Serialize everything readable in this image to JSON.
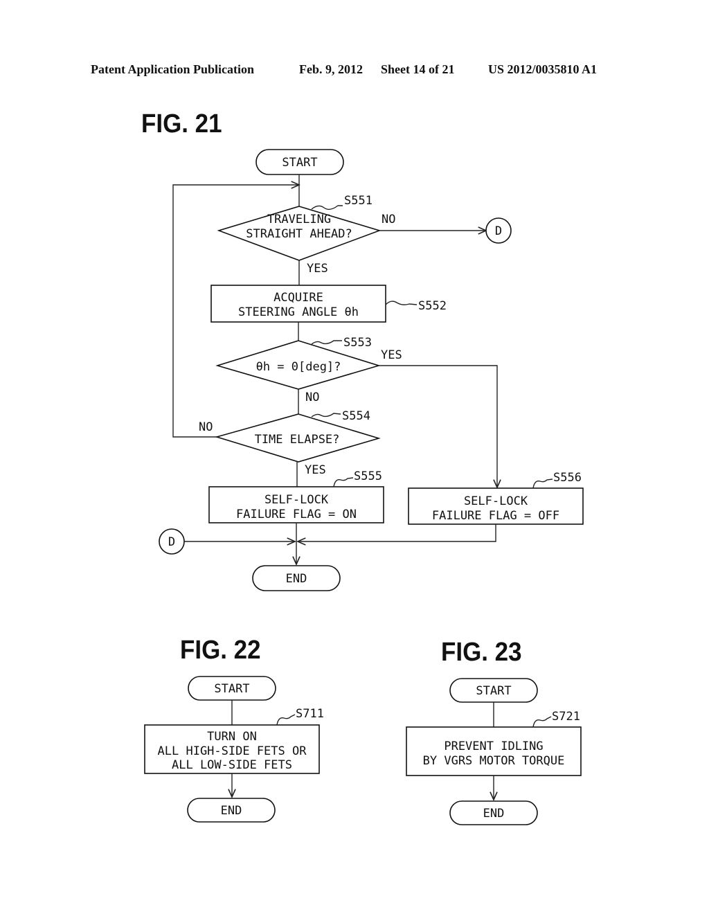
{
  "header": {
    "publication": "Patent Application Publication",
    "date": "Feb. 9, 2012",
    "sheet": "Sheet 14 of 21",
    "number": "US 2012/0035810 A1"
  },
  "fig21": {
    "title": "FIG. 21",
    "start": "START",
    "end": "END",
    "connector": "D",
    "s551": {
      "step": "S551",
      "line1": "TRAVELING",
      "line2": "STRAIGHT AHEAD?",
      "no": "NO",
      "yes": "YES"
    },
    "s552": {
      "step": "S552",
      "line1": "ACQUIRE",
      "line2": "STEERING ANGLE θh"
    },
    "s553": {
      "step": "S553",
      "text": "θh = 0[deg]?",
      "yes": "YES",
      "no": "NO"
    },
    "s554": {
      "step": "S554",
      "text": "TIME ELAPSE?",
      "no": "NO",
      "yes": "YES"
    },
    "s555": {
      "step": "S555",
      "line1": "SELF-LOCK",
      "line2": "FAILURE FLAG = ON"
    },
    "s556": {
      "step": "S556",
      "line1": "SELF-LOCK",
      "line2": "FAILURE FLAG = OFF"
    }
  },
  "fig22": {
    "title": "FIG. 22",
    "start": "START",
    "end": "END",
    "s711": {
      "step": "S711",
      "line1": "TURN ON",
      "line2": "ALL HIGH-SIDE FETS OR",
      "line3": "ALL LOW-SIDE FETS"
    }
  },
  "fig23": {
    "title": "FIG. 23",
    "start": "START",
    "end": "END",
    "s721": {
      "step": "S721",
      "line1": "PREVENT IDLING",
      "line2": "BY VGRS MOTOR TORQUE"
    }
  }
}
